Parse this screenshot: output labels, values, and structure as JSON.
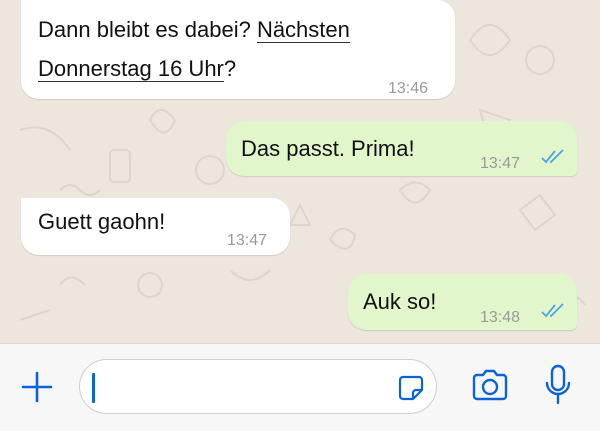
{
  "messages": [
    {
      "side": "in",
      "line1_prefix": "Dann bleibt es dabei? ",
      "line1_link": "Nächsten",
      "line2_link": "Donnerstag 16 Uhr",
      "line2_suffix": "?",
      "time": "13:46"
    },
    {
      "side": "out",
      "text": "Das passt. Prima!",
      "time": "13:47",
      "status": "read-ticks-icon"
    },
    {
      "side": "in",
      "text": "Guett gaohn!",
      "time": "13:47"
    },
    {
      "side": "out",
      "text": "Auk so!",
      "time": "13:48",
      "status": "read-ticks-icon"
    }
  ],
  "composer": {
    "input_value": "",
    "icons": [
      "plus-icon",
      "sticker-icon",
      "camera-icon",
      "microphone-icon"
    ]
  },
  "colors": {
    "accent": "#0a64d8",
    "outgoing_bubble": "#e1f7cb",
    "incoming_bubble": "#ffffff",
    "read_ticks": "#4fa3e0"
  }
}
